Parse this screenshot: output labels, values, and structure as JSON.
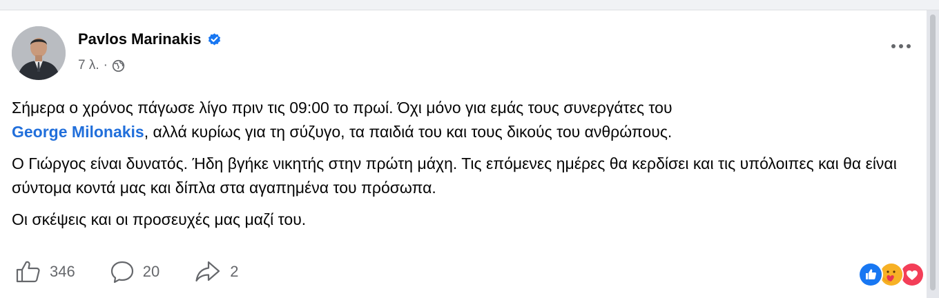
{
  "post": {
    "author": "Pavlos Marinakis",
    "verified": true,
    "time": "7 λ.",
    "separator": "·",
    "privacy_icon": "globe-icon",
    "paragraphs": {
      "p1_a": "Σήμερα ο χρόνος πάγωσε λίγο πριν τις 09:00 το πρωί. Όχι μόνο για εμάς τους συνεργάτες του",
      "p1_mention": "George Milonakis",
      "p1_b": ", αλλά κυρίως για τη σύζυγο, τα παιδιά του και τους δικούς του ανθρώπους.",
      "p2": "Ο Γιώργος είναι δυνατός. Ήδη βγήκε νικητής στην πρώτη μάχη. Τις επόμενες ημέρες θα κερδίσει και τις υπόλοιπες και θα είναι σύντομα κοντά μας και δίπλα στα αγαπημένα του πρόσωπα.",
      "p3": "Οι σκέψεις και οι προσευχές μας μαζί του."
    }
  },
  "actions": {
    "likes": "346",
    "comments": "20",
    "shares": "2"
  },
  "reactions": [
    "like-reaction-icon",
    "care-reaction-icon",
    "love-reaction-icon"
  ],
  "colors": {
    "mention": "#216fdb",
    "secondary_text": "#65676b",
    "verified": "#1877f2"
  }
}
